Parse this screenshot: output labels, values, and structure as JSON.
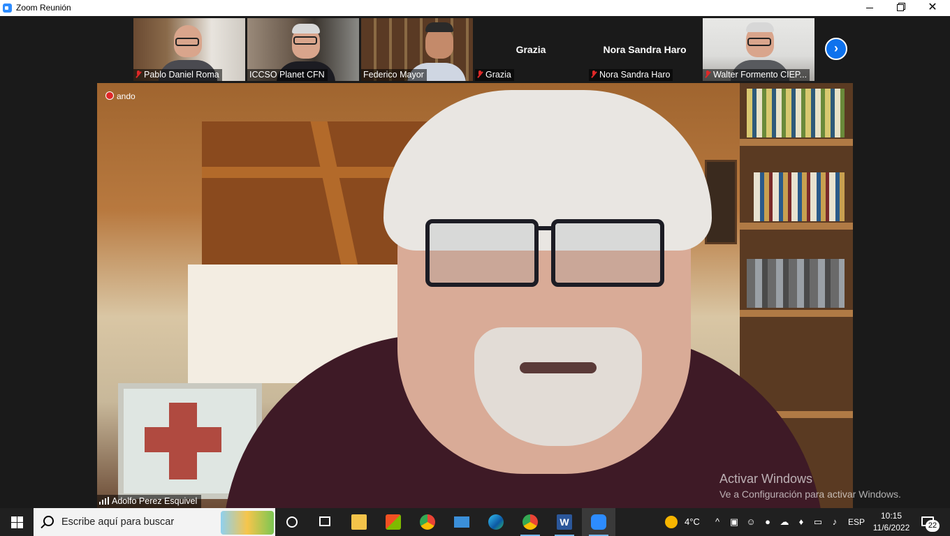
{
  "window": {
    "title": "Zoom Reunión"
  },
  "gallery": {
    "participants": [
      {
        "name": "Pablo Daniel Roma",
        "has_video": true,
        "muted": true
      },
      {
        "name": "ICCSO Planet CFN",
        "has_video": true,
        "muted": false
      },
      {
        "name": "Federico Mayor",
        "has_video": true,
        "muted": false
      },
      {
        "name": "Grazia",
        "has_video": false,
        "muted": true
      },
      {
        "name": "Nora Sandra Haro",
        "has_video": false,
        "muted": true
      },
      {
        "name": "Walter Formento CIEP...",
        "has_video": true,
        "muted": true
      }
    ],
    "next_icon": "chevron-right-icon"
  },
  "main_video": {
    "speaker_name": "Adolfo Perez Esquivel",
    "recording_label": "ando"
  },
  "watermark": {
    "title": "Activar Windows",
    "subtitle": "Ve a Configuración para activar Windows."
  },
  "taskbar": {
    "search_placeholder": "Escribe aquí para buscar",
    "weather": "4°C",
    "language": "ESP",
    "time": "10:15",
    "date": "11/6/2022",
    "notification_count": "22",
    "apps": [
      "cortana",
      "task-view",
      "file-explorer",
      "microsoft-store",
      "chrome",
      "mail",
      "edge",
      "chrome-profile",
      "word",
      "zoom"
    ]
  },
  "colors": {
    "zoom_blue": "#2d8cff",
    "mute_red": "#e02828",
    "taskbar": "#202020"
  }
}
